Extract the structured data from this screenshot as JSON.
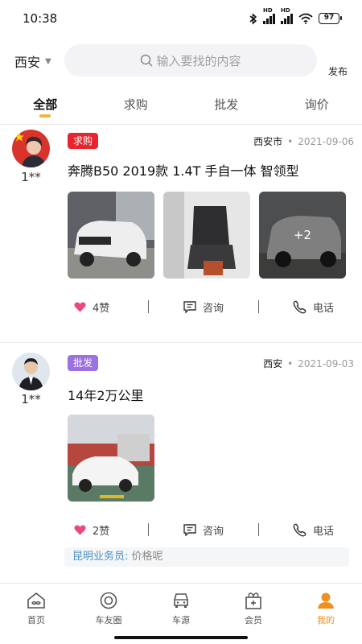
{
  "status": {
    "time": "10:38",
    "battery": "97",
    "hd": "HD"
  },
  "header": {
    "city": "西安",
    "search_placeholder": "输入要找的内容",
    "publish": "发布"
  },
  "tabs": [
    {
      "label": "全部",
      "active": true
    },
    {
      "label": "求购",
      "active": false
    },
    {
      "label": "批发",
      "active": false
    },
    {
      "label": "询价",
      "active": false
    }
  ],
  "posts": [
    {
      "user": "1**",
      "tag": "求购",
      "tag_color": "#e8242c",
      "location": "西安市",
      "dot": "•",
      "date": "2021-09-06",
      "title": "奔腾B50 2019款 1.4T 手自一体 智领型",
      "more_images": "+2",
      "likes": "4赞",
      "ask": "咨询",
      "call": "电话"
    },
    {
      "user": "1**",
      "tag": "批发",
      "tag_color": "#9b72e0",
      "location": "西安",
      "dot": "•",
      "date": "2021-09-03",
      "title": "14年2万公里",
      "likes": "2赞",
      "ask": "咨询",
      "call": "电话",
      "comment": {
        "name": "昆明业务员:",
        "text": " 价格呢"
      }
    }
  ],
  "nav": [
    {
      "label": "首页",
      "icon": "home-icon"
    },
    {
      "label": "车友圈",
      "icon": "camera-circle-icon"
    },
    {
      "label": "车源",
      "icon": "car-icon"
    },
    {
      "label": "会员",
      "icon": "gift-icon"
    },
    {
      "label": "我的",
      "icon": "person-icon",
      "active": true
    }
  ],
  "colors": {
    "accent": "#f09020",
    "like": "#e94a7c",
    "tab_indicator": "#f2b53c"
  }
}
